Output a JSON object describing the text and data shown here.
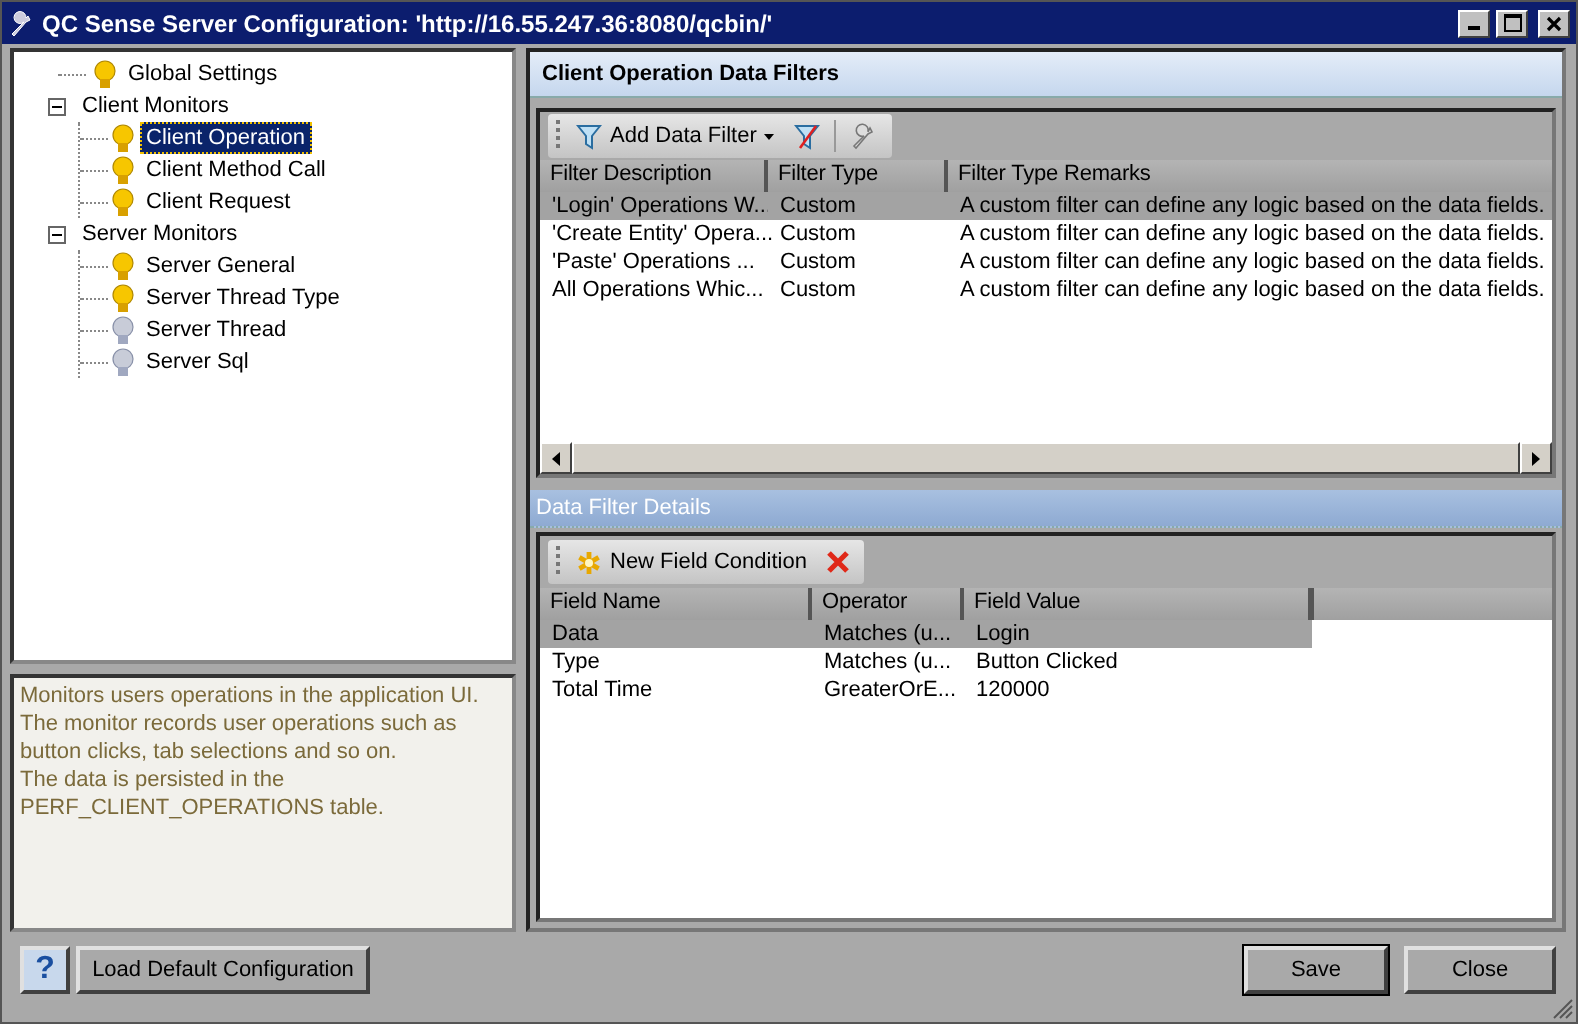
{
  "window": {
    "title": "QC Sense Server Configuration: 'http://16.55.247.36:8080/qcbin/'"
  },
  "tree": [
    {
      "kind": "leaf",
      "label": "Global Settings",
      "enabled": true,
      "selected": false
    },
    {
      "kind": "group",
      "label": "Client Monitors",
      "expanded": true,
      "selected": false,
      "children": [
        {
          "kind": "leaf",
          "label": "Client Operation",
          "enabled": true,
          "selected": true
        },
        {
          "kind": "leaf",
          "label": "Client Method Call",
          "enabled": true,
          "selected": false
        },
        {
          "kind": "leaf",
          "label": "Client Request",
          "enabled": true,
          "selected": false
        }
      ]
    },
    {
      "kind": "group",
      "label": "Server Monitors",
      "expanded": true,
      "selected": false,
      "children": [
        {
          "kind": "leaf",
          "label": "Server General",
          "enabled": true,
          "selected": false
        },
        {
          "kind": "leaf",
          "label": "Server Thread Type",
          "enabled": true,
          "selected": false
        },
        {
          "kind": "leaf",
          "label": "Server Thread",
          "enabled": false,
          "selected": false
        },
        {
          "kind": "leaf",
          "label": "Server Sql",
          "enabled": false,
          "selected": false
        }
      ]
    }
  ],
  "description": [
    "Monitors users operations in the application UI.",
    "The monitor records user operations such as button clicks, tab selections and so on.",
    "The data is persisted in the PERF_CLIENT_OPERATIONS table."
  ],
  "filters_panel": {
    "title": "Client Operation Data Filters",
    "add_label": "Add Data Filter",
    "columns": [
      "Filter Description",
      "Filter Type",
      "Filter Type Remarks"
    ],
    "rows": [
      {
        "cells": [
          "'Login' Operations W...",
          "Custom",
          "A custom filter can define any logic based on the data fields."
        ],
        "selected": true
      },
      {
        "cells": [
          "'Create Entity' Opera...",
          "Custom",
          "A custom filter can define any logic based on the data fields."
        ],
        "selected": false
      },
      {
        "cells": [
          "'Paste' Operations ...",
          "Custom",
          "A custom filter can define any logic based on the data fields."
        ],
        "selected": false
      },
      {
        "cells": [
          "All Operations Whic...",
          "Custom",
          "A custom filter can define any logic based on the data fields."
        ],
        "selected": false
      }
    ]
  },
  "details_panel": {
    "title": "Data Filter Details",
    "new_label": "New Field Condition",
    "columns": [
      "Field Name",
      "Operator",
      "Field Value"
    ],
    "rows": [
      {
        "cells": [
          "Data",
          "Matches (u...",
          "Login"
        ],
        "selected": true
      },
      {
        "cells": [
          "Type",
          "Matches (u...",
          "Button Clicked"
        ],
        "selected": false
      },
      {
        "cells": [
          "Total Time",
          "GreaterOrE...",
          "120000"
        ],
        "selected": false
      }
    ]
  },
  "footer": {
    "help": "?",
    "load_default": "Load Default Configuration",
    "save": "Save",
    "close": "Close"
  }
}
